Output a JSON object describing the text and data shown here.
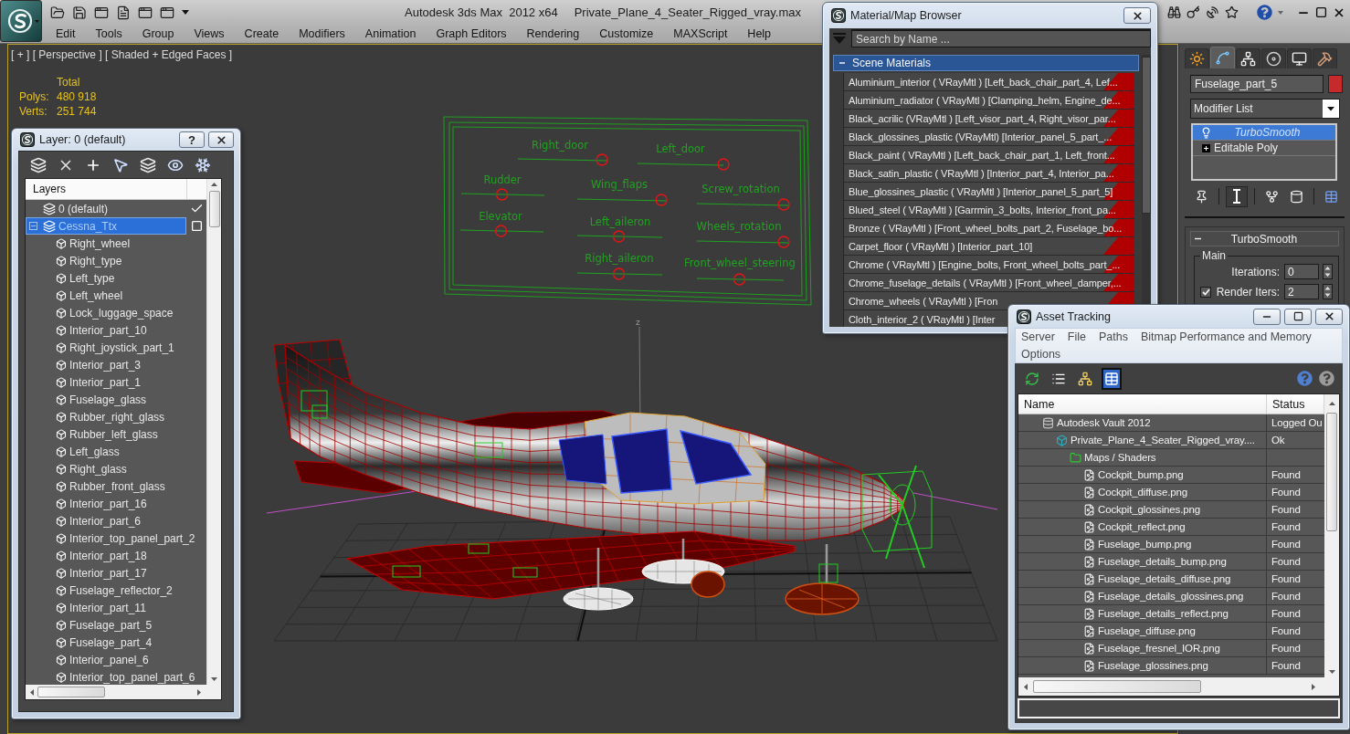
{
  "title_bar": {
    "app_title": "Autodesk 3ds Max  2012 x64",
    "file_name": "Private_Plane_4_Seater_Rigged_vray.max"
  },
  "menu_bar": [
    "Edit",
    "Tools",
    "Group",
    "Views",
    "Create",
    "Modifiers",
    "Animation",
    "Graph Editors",
    "Rendering",
    "Customize",
    "MAXScript",
    "Help"
  ],
  "viewport": {
    "label": "[ + ] [ Perspective ] [ Shaded + Edged Faces ]",
    "stats_heading": "Total",
    "stats": [
      {
        "label": "Polys:",
        "value": "480 918"
      },
      {
        "label": "Verts:",
        "value": "251 744"
      }
    ],
    "axis_label": "z",
    "rig_controls": [
      {
        "label": "Right_door",
        "level": 0.94
      },
      {
        "label": "Left_door",
        "level": 1
      },
      {
        "label": "Rudder",
        "level": 0.49
      },
      {
        "label": "Wing_flaps",
        "level": 0.94
      },
      {
        "label": "Screw_rotation",
        "level": 0.95
      },
      {
        "label": "Elevator",
        "level": 0.49
      },
      {
        "label": "Left_aileron",
        "level": 0.49
      },
      {
        "label": "Wheels_rotation",
        "level": 0.95
      },
      {
        "label": "Right_aileron",
        "level": 0.49
      },
      {
        "label": "Front_wheel_steering",
        "level": 0.49
      }
    ]
  },
  "layer_window": {
    "title": "Layer: 0 (default)",
    "help_button": "?",
    "list_header": "Layers",
    "layers": [
      {
        "name": "0 (default)",
        "selected": false,
        "current": true
      },
      {
        "name": "Cessna_Ttx",
        "selected": true,
        "current": false,
        "expanded": true,
        "children": [
          {
            "name": "Right_wheel",
            "selected": false
          },
          {
            "name": "Right_type",
            "selected": false
          },
          {
            "name": "Left_type",
            "selected": false
          },
          {
            "name": "Left_wheel",
            "selected": false
          },
          {
            "name": "Lock_luggage_space",
            "selected": false
          },
          {
            "name": "Interior_part_10",
            "selected": false
          },
          {
            "name": "Right_joystick_part_1",
            "selected": false
          },
          {
            "name": "Interior_part_3",
            "selected": false
          },
          {
            "name": "Interior_part_1",
            "selected": false
          },
          {
            "name": "Fuselage_glass",
            "selected": false
          },
          {
            "name": "Rubber_right_glass",
            "selected": false
          },
          {
            "name": "Rubber_left_glass",
            "selected": false
          },
          {
            "name": "Left_glass",
            "selected": false
          },
          {
            "name": "Right_glass",
            "selected": false
          },
          {
            "name": "Rubber_front_glass",
            "selected": false
          },
          {
            "name": "Interior_part_16",
            "selected": false
          },
          {
            "name": "Interior_part_6",
            "selected": false
          },
          {
            "name": "Interior_top_panel_part_2",
            "selected": false
          },
          {
            "name": "Interior_part_18",
            "selected": false
          },
          {
            "name": "Interior_part_17",
            "selected": false
          },
          {
            "name": "Fuselage_reflector_2",
            "selected": false
          },
          {
            "name": "Interior_part_11",
            "selected": false
          },
          {
            "name": "Fuselage_part_5",
            "selected": false
          },
          {
            "name": "Fuselage_part_4",
            "selected": false
          },
          {
            "name": "Interior_panel_6",
            "selected": false
          },
          {
            "name": "Interior_top_panel_part_6",
            "selected": false
          }
        ]
      }
    ]
  },
  "material_browser": {
    "title": "Material/Map Browser",
    "search": {
      "placeholder": "Search by Name ..."
    },
    "section": {
      "title": "Scene Materials",
      "expanded": true
    },
    "materials": [
      {
        "text": "Aluminium_interior ( VRayMtl ) [Left_back_chair_part_4, Lef...",
        "selected": false
      },
      {
        "text": "Aluminium_radiator ( VRayMtl ) [Clamping_helm, Engine_de...",
        "selected": false
      },
      {
        "text": "Black_acrilic (VRayMtl ) [Left_visor_part_4, Right_visor_par...",
        "selected": false
      },
      {
        "text": "Black_glossines_plastic (VRayMtl) [Interior_panel_5_part_...",
        "selected": false
      },
      {
        "text": "Black_paint ( VRayMtl ) [Left_back_chair_part_1, Left_front...",
        "selected": false
      },
      {
        "text": "Black_satin_plastic ( VRayMtl ) [Interior_part_4, Interior_pa...",
        "selected": false
      },
      {
        "text": "Blue_glossines_plastic ( VRayMtl ) [Interior_panel_5_part_5]",
        "selected": false
      },
      {
        "text": "Blued_steel ( VRayMtl ) [Garrmin_3_bolts, Interior_front_pa...",
        "selected": false
      },
      {
        "text": "Bronze ( VRayMtl ) [Front_wheel_bolts_part_2, Fuselage_bo...",
        "selected": false
      },
      {
        "text": "Carpet_floor ( VRayMtl ) [Interior_part_10]",
        "selected": false
      },
      {
        "text": "Chrome ( VRayMtl ) [Engine_bolts, Front_wheel_bolts_part_...",
        "selected": false
      },
      {
        "text": "Chrome_fuselage_details ( VRayMtl ) [Front_wheel_damper,...",
        "selected": false
      },
      {
        "text": "Chrome_wheels ( VRayMtl ) [Fron",
        "selected": false
      },
      {
        "text": "Cloth_interior_2 ( VRayMtl ) [Inter",
        "selected": false
      }
    ]
  },
  "command_panel": {
    "tabs": [
      {
        "kind": "create",
        "selected": false
      },
      {
        "kind": "modify",
        "selected": true
      },
      {
        "kind": "hierarchy",
        "selected": false
      },
      {
        "kind": "motion",
        "selected": false
      },
      {
        "kind": "display",
        "selected": false
      },
      {
        "kind": "utilities",
        "selected": false
      }
    ],
    "object_name": "Fuselage_part_5",
    "modifier_list": "Modifier List",
    "modifier_stack": [
      {
        "kind": "modifier",
        "name": "TurboSmooth",
        "selected": true
      },
      {
        "kind": "base_object",
        "name": "Editable Poly",
        "selected": false
      }
    ],
    "stack_tools": [
      {
        "kind": "pin",
        "selected": false
      },
      {
        "kind": "end_result",
        "selected": true
      },
      {
        "kind": "make_unique",
        "selected": false
      },
      {
        "kind": "remove",
        "selected": false
      },
      {
        "kind": "configure",
        "selected": false
      }
    ],
    "rollout": {
      "title": "TurboSmooth",
      "expanded": true,
      "group": "Main",
      "fields": [
        {
          "kind": "spinner",
          "label": "Iterations:",
          "value": "0"
        },
        {
          "kind": "check_spinner",
          "label": "Render Iters:",
          "value": "2",
          "checked": true
        }
      ]
    }
  },
  "asset_tracking": {
    "title": "Asset Tracking",
    "menu": [
      "Server",
      "File",
      "Paths",
      "Bitmap Performance and Memory",
      "Options"
    ],
    "toolbar": [
      {
        "kind": "refresh",
        "selected": false
      },
      {
        "kind": "list",
        "selected": false
      },
      {
        "kind": "tree",
        "selected": false
      },
      {
        "kind": "table",
        "selected": true
      }
    ],
    "columns": [
      "Name",
      "Status"
    ],
    "rows": [
      {
        "kind": "vault",
        "name": "Autodesk Vault 2012",
        "status": "Logged Ou",
        "selected": false,
        "children": [
          {
            "kind": "scene",
            "name": "Private_Plane_4_Seater_Rigged_vray....",
            "status": "Ok",
            "selected": false,
            "children": [
              {
                "kind": "folder",
                "name": "Maps / Shaders",
                "selected": false,
                "children": [
                  {
                    "kind": "bitmap",
                    "name": "Cockpit_bump.png",
                    "status": "Found",
                    "selected": false
                  },
                  {
                    "kind": "bitmap",
                    "name": "Cockpit_diffuse.png",
                    "status": "Found",
                    "selected": false
                  },
                  {
                    "kind": "bitmap",
                    "name": "Cockpit_glossines.png",
                    "status": "Found",
                    "selected": false
                  },
                  {
                    "kind": "bitmap",
                    "name": "Cockpit_reflect.png",
                    "status": "Found",
                    "selected": false
                  },
                  {
                    "kind": "bitmap",
                    "name": "Fuselage_bump.png",
                    "status": "Found",
                    "selected": false
                  },
                  {
                    "kind": "bitmap",
                    "name": "Fuselage_details_bump.png",
                    "status": "Found",
                    "selected": false
                  },
                  {
                    "kind": "bitmap",
                    "name": "Fuselage_details_diffuse.png",
                    "status": "Found",
                    "selected": false
                  },
                  {
                    "kind": "bitmap",
                    "name": "Fuselage_details_glossines.png",
                    "status": "Found",
                    "selected": false
                  },
                  {
                    "kind": "bitmap",
                    "name": "Fuselage_details_reflect.png",
                    "status": "Found",
                    "selected": false
                  },
                  {
                    "kind": "bitmap",
                    "name": "Fuselage_diffuse.png",
                    "status": "Found",
                    "selected": false
                  },
                  {
                    "kind": "bitmap",
                    "name": "Fuselage_fresnel_IOR.png",
                    "status": "Found",
                    "selected": false
                  },
                  {
                    "kind": "bitmap",
                    "name": "Fuselage_glossines.png",
                    "status": "Found",
                    "selected": false
                  }
                ]
              }
            ]
          }
        ]
      }
    ]
  }
}
